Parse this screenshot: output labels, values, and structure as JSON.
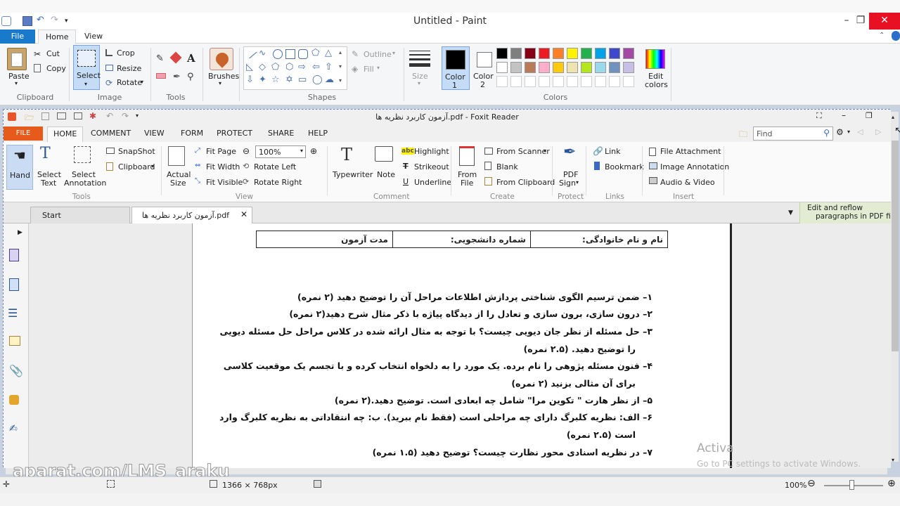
{
  "paint": {
    "title": "Untitled - Paint",
    "menu": {
      "file": "File",
      "home": "Home",
      "view": "View"
    },
    "clipboard": {
      "paste": "Paste",
      "cut": "Cut",
      "copy": "Copy",
      "label": "Clipboard"
    },
    "image": {
      "select": "Select",
      "crop": "Crop",
      "resize": "Resize",
      "rotate": "Rotate",
      "label": "Image"
    },
    "tools": {
      "label": "Tools"
    },
    "brushes": {
      "label": "Brushes"
    },
    "shapes": {
      "outline": "Outline",
      "fill": "Fill",
      "label": "Shapes"
    },
    "size": {
      "label": "Size"
    },
    "color1": {
      "label": "Color",
      "num": "1"
    },
    "color2": {
      "label": "Color",
      "num": "2"
    },
    "colors": {
      "label": "Colors",
      "edit": "Edit",
      "edit2": "colors",
      "row1": [
        "#000000",
        "#7f7f7f",
        "#880015",
        "#ed1c24",
        "#ff7f27",
        "#fff200",
        "#22b14c",
        "#00a2e8",
        "#3f48cc",
        "#a349a4"
      ],
      "row2": [
        "#ffffff",
        "#c3c3c3",
        "#b97a57",
        "#ffaec9",
        "#ffc90e",
        "#efe4b0",
        "#b5e61d",
        "#99d9ea",
        "#7092be",
        "#c8bfe7"
      ]
    },
    "status": {
      "dimensions": "1366 × 768px",
      "zoom": "100%"
    }
  },
  "foxit": {
    "title": "آزمون کاربرد نظریه ها.pdf - Foxit Reader",
    "tabs": [
      "FILE",
      "HOME",
      "COMMENT",
      "VIEW",
      "FORM",
      "PROTECT",
      "SHARE",
      "HELP"
    ],
    "search_placeholder": "Find",
    "tools": {
      "hand": "Hand",
      "select_text_1": "Select",
      "select_text_2": "Text",
      "select_annot_1": "Select",
      "select_annot_2": "Annotation",
      "snapshot": "SnapShot",
      "clipboard": "Clipboard",
      "label": "Tools"
    },
    "view": {
      "actual_1": "Actual",
      "actual_2": "Size",
      "fit_page": "Fit Page",
      "fit_width": "Fit Width",
      "fit_visible": "Fit Visible",
      "zoom": "100%",
      "rotate_left": "Rotate Left",
      "rotate_right": "Rotate Right",
      "label": "View"
    },
    "comment": {
      "typewriter": "Typewriter",
      "note": "Note",
      "highlight": "Highlight",
      "strikeout": "Strikeout",
      "underline": "Underline",
      "label": "Comment"
    },
    "create": {
      "from_file_1": "From",
      "from_file_2": "File",
      "from_scanner": "From Scanner",
      "blank": "Blank",
      "from_clipboard": "From Clipboard",
      "label": "Create"
    },
    "protect": {
      "pdf_sign_1": "PDF",
      "pdf_sign_2": "Sign",
      "label": "Protect"
    },
    "links": {
      "link": "Link",
      "bookmark": "Bookmark",
      "label": "Links"
    },
    "insert": {
      "file_attachment": "File Attachment",
      "image_annotation": "Image Annotation",
      "audio_video": "Audio & Video",
      "label": "Insert"
    },
    "doc_tabs": {
      "start": "Start",
      "file": "آزمون کاربرد نظریه ها.pdf"
    },
    "promo": {
      "line1": "Edit and reflow",
      "line2": "paragraphs in PDF fi"
    }
  },
  "document": {
    "header": {
      "name": "نام و نام خانوادگی:",
      "student_no": "شماره دانشجویی:",
      "duration": "مدت آزمون"
    },
    "questions": [
      "۱– ضمن ترسیم الگوی شناختی پردازش اطلاعات مراحل آن را توضیح دهید (۲ نمره)",
      "۲– درون سازی، برون سازی و تعادل را از دیدگاه پیاژه با ذکر مثال شرح دهید(۲ نمره)",
      "۳– حل مسئله از نظر جان دیویی چیست؟ با توجه به مثال ارائه شده در کلاس مراحل حل مسئله دیویی",
      "را توضیح دهید. (۲.۵ نمره)",
      "۴– فنون مسئله پژوهی را نام برده. یک مورد را به دلخواه انتخاب کرده و با تجسم یک موقعیت کلاسی",
      "برای آن مثالی بزنید (۲ نمره)",
      "۵– از نظر هارت \" تکوین مرا\" شامل چه ابعادی است. توضیح دهید.(۲ نمره)",
      "۶– الف: نظریه کلبرگ دارای چه مراحلی است (فقط نام ببرید). ب: چه انتقاداتی به نظریه کلبرگ وارد",
      "است (۲.۵ نمره)",
      "۷– در نظریه اسنادی محور نظارت چیست؟ توضیح دهید (۱.۵ نمره)"
    ]
  },
  "watermarks": {
    "activate": "Activa",
    "activate_sub": "Go to PC settings to activate Windows.",
    "site": "aparat.com/LMS_araku"
  }
}
